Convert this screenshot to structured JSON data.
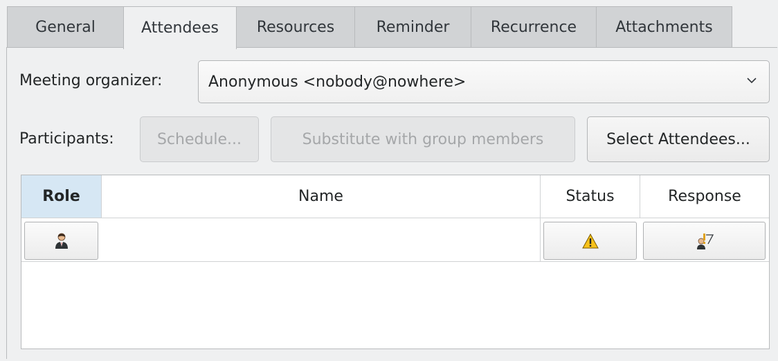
{
  "tabs": [
    {
      "label": "General",
      "active": false
    },
    {
      "label": "Attendees",
      "active": true
    },
    {
      "label": "Resources",
      "active": false
    },
    {
      "label": "Reminder",
      "active": false
    },
    {
      "label": "Recurrence",
      "active": false
    },
    {
      "label": "Attachments",
      "active": false
    }
  ],
  "organizer": {
    "label": "Meeting organizer:",
    "value": "Anonymous <nobody@nowhere>"
  },
  "participants": {
    "label": "Participants:",
    "schedule_button": "Schedule...",
    "substitute_button": "Substitute with group members",
    "select_button": "Select Attendees..."
  },
  "table": {
    "headers": [
      "Role",
      "Name",
      "Status",
      "Response"
    ],
    "rows": [
      {
        "role_icon": "attendee-person-icon",
        "name": "",
        "status_icon": "warning-icon",
        "response_icon": "request-response-icon"
      }
    ]
  }
}
